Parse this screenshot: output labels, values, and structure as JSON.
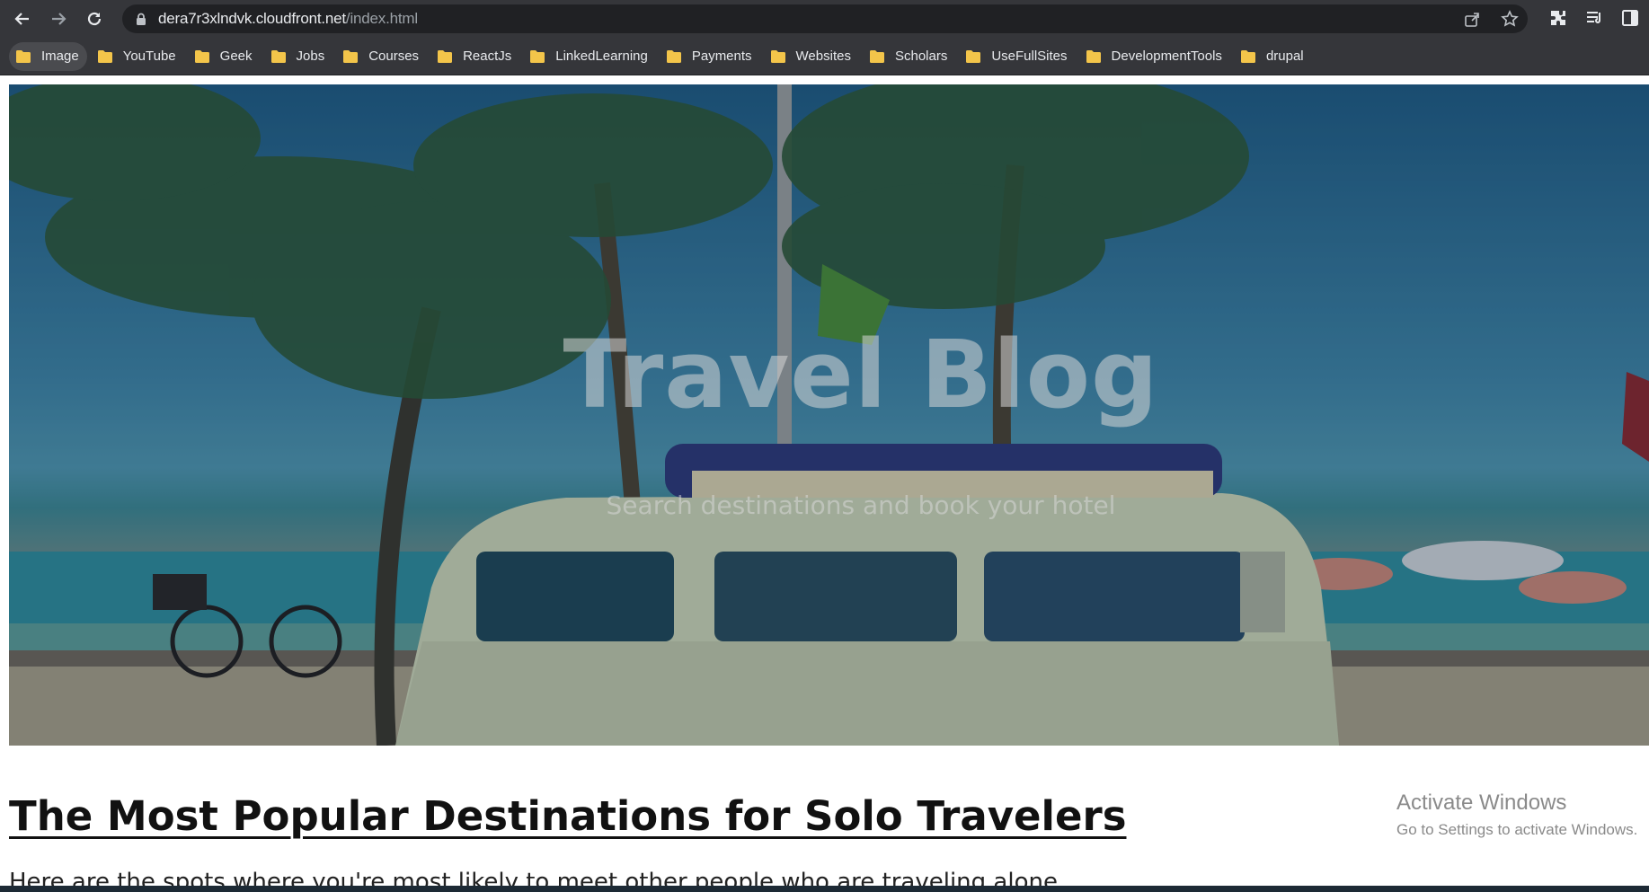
{
  "browser": {
    "url_host": "dera7r3xlndvk.cloudfront.net",
    "url_path": "/index.html",
    "bookmarks": [
      "Image",
      "YouTube",
      "Geek",
      "Jobs",
      "Courses",
      "ReactJs",
      "LinkedLearning",
      "Payments",
      "Websites",
      "Scholars",
      "UseFullSites",
      "DevelopmentTools",
      "drupal"
    ]
  },
  "hero": {
    "title": "Travel Blog",
    "subtitle": "Search destinations and book your hotel"
  },
  "section": {
    "title": "The Most Popular Destinations for Solo Travelers",
    "text": "Here are the spots where you're most likely to meet other people who are traveling alone."
  },
  "watermark": {
    "line1": "Activate Windows",
    "line2": "Go to Settings to activate Windows."
  },
  "colors": {
    "chrome": "#35363a",
    "omnibox": "#202124",
    "folder": "#f3c54a"
  }
}
